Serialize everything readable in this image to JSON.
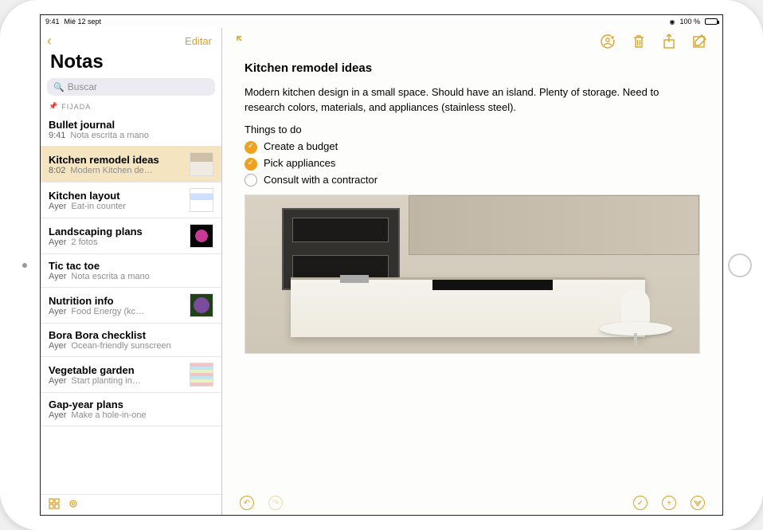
{
  "status": {
    "time": "9:41",
    "date": "Mié 12 sept",
    "battery": "100 %"
  },
  "sidebar": {
    "edit_label": "Editar",
    "title": "Notas",
    "search_placeholder": "Buscar",
    "pinned_label": "FIJADA",
    "view_icon": "grid-icon",
    "attach_icon": "attachment-icon",
    "items": [
      {
        "title": "Bullet journal",
        "time": "9:41",
        "preview": "Nota escrita a mano",
        "thumb": null,
        "selected": false
      },
      {
        "title": "Kitchen remodel ideas",
        "time": "8:02",
        "preview": "Modern Kitchen de…",
        "thumb": "kitchen",
        "selected": true
      },
      {
        "title": "Kitchen layout",
        "time": "Ayer",
        "preview": "Eat-in counter",
        "thumb": "layout",
        "selected": false
      },
      {
        "title": "Landscaping plans",
        "time": "Ayer",
        "preview": "2 fotos",
        "thumb": "flower",
        "selected": false
      },
      {
        "title": "Tic tac toe",
        "time": "Ayer",
        "preview": "Nota escrita a mano",
        "thumb": null,
        "selected": false
      },
      {
        "title": "Nutrition info",
        "time": "Ayer",
        "preview": "Food Energy (kc…",
        "thumb": "veg",
        "selected": false
      },
      {
        "title": "Bora Bora checklist",
        "time": "Ayer",
        "preview": "Ocean-friendly sunscreen",
        "thumb": null,
        "selected": false
      },
      {
        "title": "Vegetable garden",
        "time": "Ayer",
        "preview": "Start planting in…",
        "thumb": "plan",
        "selected": false
      },
      {
        "title": "Gap-year plans",
        "time": "Ayer",
        "preview": "Make a hole-in-one",
        "thumb": null,
        "selected": false
      }
    ]
  },
  "detail": {
    "title": "Kitchen remodel ideas",
    "body": "Modern kitchen design in a small space. Should have an island. Plenty of storage. Need to research colors, materials, and appliances (stainless steel).",
    "todo_heading": "Things to do",
    "todos": [
      {
        "label": "Create a budget",
        "done": true
      },
      {
        "label": "Pick appliances",
        "done": true
      },
      {
        "label": "Consult with a contractor",
        "done": false
      }
    ],
    "toolbar_icons": {
      "expand": "expand-icon",
      "add_person": "add-person-icon",
      "trash": "trash-icon",
      "share": "share-icon",
      "compose": "compose-icon"
    },
    "bottom_icons": {
      "undo": "undo-icon",
      "redo": "redo-icon",
      "checklist": "checklist-icon",
      "add": "add-icon",
      "style": "style-icon"
    }
  }
}
